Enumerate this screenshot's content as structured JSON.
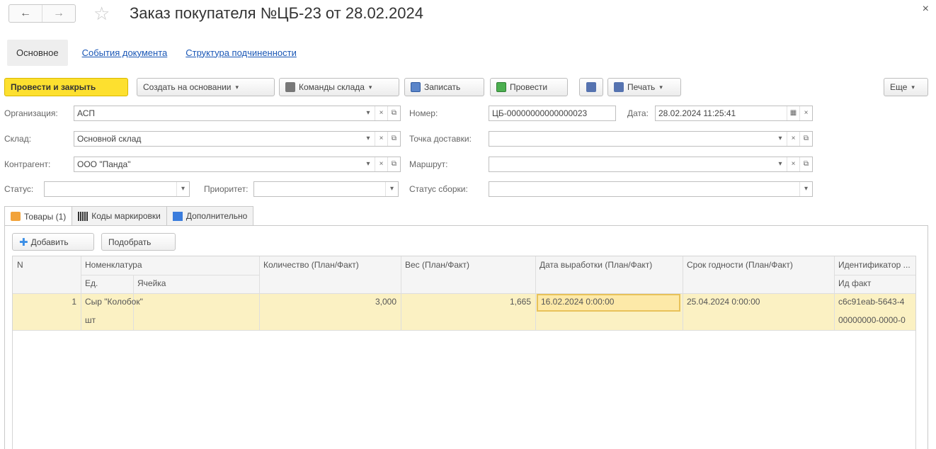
{
  "window": {
    "title": "Заказ покупателя №ЦБ-23 от 28.02.2024",
    "back": "←",
    "forward": "→",
    "star": "☆",
    "close": "×"
  },
  "top_tabs": {
    "main": "Основное",
    "events": "События документа",
    "structure": "Структура подчиненности"
  },
  "toolbar": {
    "post_close": "Провести и закрыть",
    "create_based": "Создать на основании",
    "warehouse_cmds": "Команды склада",
    "save": "Записать",
    "post": "Провести",
    "print": "Печать",
    "more": "Еще",
    "dropdown": "▾"
  },
  "form": {
    "org_label": "Организация:",
    "org_value": "АСП",
    "number_label": "Номер:",
    "number_value": "ЦБ-00000000000000023",
    "date_label": "Дата:",
    "date_value": "28.02.2024 11:25:41",
    "warehouse_label": "Склад:",
    "warehouse_value": "Основной склад",
    "delivery_label": "Точка доставки:",
    "delivery_value": "",
    "contractor_label": "Контрагент:",
    "contractor_value": "ООО \"Панда\"",
    "route_label": "Маршрут:",
    "route_value": "",
    "status_label": "Статус:",
    "status_value": "",
    "priority_label": "Приоритет:",
    "priority_value": "",
    "assembly_label": "Статус сборки:",
    "assembly_value": "",
    "btn_dropdown": "▾",
    "btn_clear": "×",
    "btn_open": "⧉",
    "btn_calendar": "▦"
  },
  "doc_tabs": {
    "goods": "Товары (1)",
    "codes": "Коды маркировки",
    "extra": "Дополнительно"
  },
  "goods": {
    "add": "Добавить",
    "pick": "Подобрать",
    "columns": {
      "n": "N",
      "nomenclature": "Номенклатура",
      "unit": "Ед.",
      "cell": "Ячейка",
      "quantity": "Количество (План/Факт)",
      "weight": "Вес (План/Факт)",
      "production_date": "Дата выработки (План/Факт)",
      "expiry": "Срок годности (План/Факт)",
      "identifier": "Идентификатор ...",
      "id_fact": "Ид факт"
    },
    "rows": [
      {
        "n": "1",
        "nomenclature": "Сыр \"Колобок\"",
        "unit": "шт",
        "cell": "",
        "quantity": "3,000",
        "weight": "1,665",
        "production_date": "16.02.2024 0:00:00",
        "expiry": "25.04.2024 0:00:00",
        "identifier": "c6c91eab-5643-4",
        "id_fact": "00000000-0000-0"
      }
    ]
  }
}
